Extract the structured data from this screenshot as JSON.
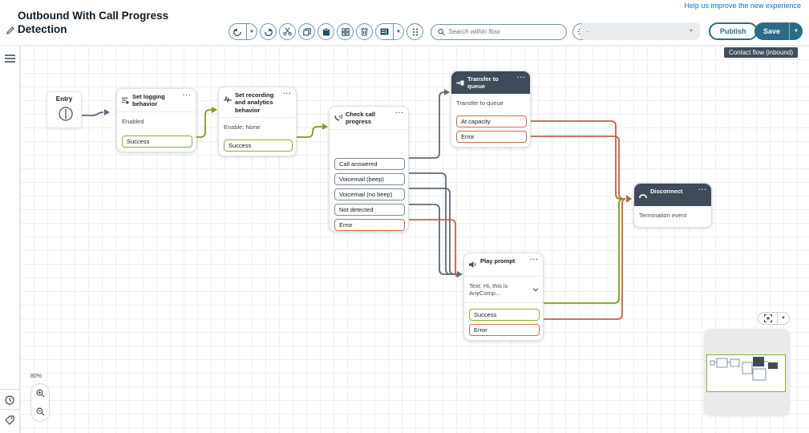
{
  "header": {
    "help_link": "Help us improve the new experience",
    "title": "Outbound With Call Progress Detection",
    "search_placeholder": "Search within flow",
    "version_value": "-",
    "publish_label": "Publish",
    "save_label": "Save",
    "flow_type_badge": "Contact flow (inbound)"
  },
  "canvas": {
    "zoom_percent": "80%"
  },
  "flow": {
    "entry_label": "Entry",
    "blocks": [
      {
        "title": "Set logging behavior",
        "body": "Enabled",
        "ports": [
          {
            "label": "Success",
            "type": "success"
          }
        ]
      },
      {
        "title": "Set recording and analytics behavior",
        "body": "Enable: None",
        "ports": [
          {
            "label": "Success",
            "type": "success"
          }
        ]
      },
      {
        "title": "Check call progress",
        "body": "",
        "ports": [
          {
            "label": "Call answered",
            "type": "neutral"
          },
          {
            "label": "Voicemail (beep)",
            "type": "neutral"
          },
          {
            "label": "Voicemail (no beep)",
            "type": "neutral"
          },
          {
            "label": "Not detected",
            "type": "neutral"
          },
          {
            "label": "Error",
            "type": "error"
          }
        ]
      },
      {
        "title": "Transfer to queue",
        "body": "Transfer to queue",
        "ports": [
          {
            "label": "At capacity",
            "type": "error"
          },
          {
            "label": "Error",
            "type": "error"
          }
        ]
      },
      {
        "title": "Play prompt",
        "body": "Text: Hi, this is AnyComp...",
        "ports": [
          {
            "label": "Success",
            "type": "success"
          },
          {
            "label": "Error",
            "type": "error"
          }
        ]
      },
      {
        "title": "Disconnect",
        "body": "Termination event",
        "ports": []
      }
    ]
  },
  "colors": {
    "accent": "#2a6c87",
    "success_wire": "#7aa116",
    "error_wire": "#c96144",
    "neutral_wire": "#5f6b7a",
    "dark_header": "#3f4b59",
    "link": "#0972d3"
  }
}
